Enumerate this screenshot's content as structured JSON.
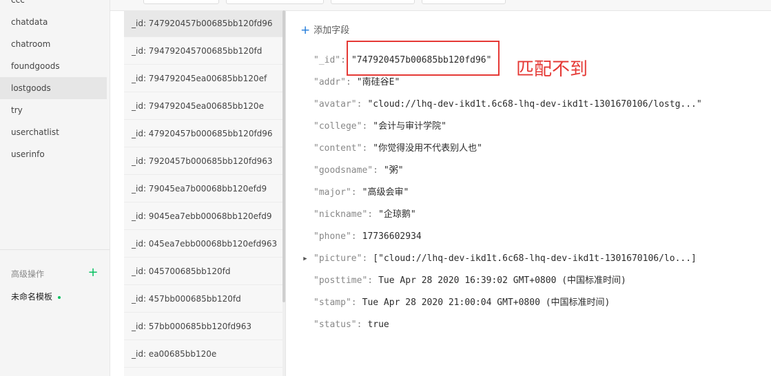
{
  "collections": [
    {
      "label": "ccc",
      "selected": false
    },
    {
      "label": "chatdata",
      "selected": false
    },
    {
      "label": "chatroom",
      "selected": false
    },
    {
      "label": "foundgoods",
      "selected": false
    },
    {
      "label": "lostgoods",
      "selected": true
    },
    {
      "label": "try",
      "selected": false
    },
    {
      "label": "userchatlist",
      "selected": false
    },
    {
      "label": "userinfo",
      "selected": false
    }
  ],
  "advanced": {
    "label": "高级操作",
    "add_icon": "plus-icon",
    "template_label": "未命名模板"
  },
  "records": [
    "_id: 747920457b00685bb120fd96",
    "_id: 794792045700685bb120fd",
    "_id: 794792045ea00685bb120ef",
    "_id: 794792045ea00685bb120e",
    "_id: 47920457b000685bb120fd96",
    "_id: 7920457b000685bb120fd963",
    "_id: 79045ea7b00068bb120efd9",
    "_id: 9045ea7ebb00068bb120efd9",
    "_id: 045ea7ebb00068bb120efd963",
    "_id: 045700685bb120fd",
    "_id: 457bb000685bb120fd",
    "_id: 57bb000685bb120fd963",
    "_id: ea00685bb120e"
  ],
  "selected_record_index": 0,
  "detail": {
    "add_field_label": "添加字段",
    "fields": [
      {
        "key": "\"_id\"",
        "value": "\"747920457b00685bb120fd96\"",
        "type": "string"
      },
      {
        "key": "\"addr\"",
        "value": "\"南硅谷E\"",
        "type": "string"
      },
      {
        "key": "\"avatar\"",
        "value": "\"cloud://lhq-dev-ikd1t.6c68-lhq-dev-ikd1t-1301670106/lostg...\"",
        "type": "string"
      },
      {
        "key": "\"college\"",
        "value": "\"会计与审计学院\"",
        "type": "string"
      },
      {
        "key": "\"content\"",
        "value": "\"你觉得没用不代表别人也\"",
        "type": "string"
      },
      {
        "key": "\"goodsname\"",
        "value": "\"粥\"",
        "type": "string"
      },
      {
        "key": "\"major\"",
        "value": "\"高级会审\"",
        "type": "string"
      },
      {
        "key": "\"nickname\"",
        "value": "\"企琼鹅\"",
        "type": "string"
      },
      {
        "key": "\"phone\"",
        "value": "17736602934",
        "type": "number"
      },
      {
        "key": "\"picture\"",
        "value": "[\"cloud://lhq-dev-ikd1t.6c68-lhq-dev-ikd1t-1301670106/lo...]",
        "type": "array",
        "expandable": true
      },
      {
        "key": "\"posttime\"",
        "value": "Tue Apr 28 2020 16:39:02 GMT+0800 (中国标准时间)",
        "type": "date"
      },
      {
        "key": "\"stamp\"",
        "value": "Tue Apr 28 2020 21:00:04 GMT+0800 (中国标准时间)",
        "type": "date"
      },
      {
        "key": "\"status\"",
        "value": "true",
        "type": "bool"
      }
    ]
  },
  "annotation": {
    "text": "匹配不到",
    "color": "#e53935"
  },
  "colors": {
    "accent_green": "#07c160",
    "accent_blue": "#1f7ad9",
    "highlight_red": "#e53935"
  }
}
